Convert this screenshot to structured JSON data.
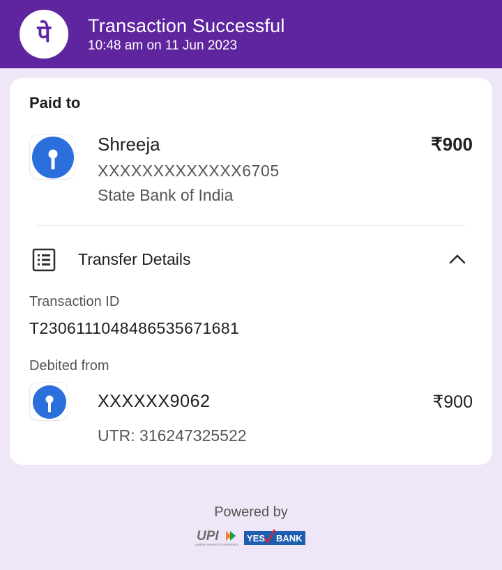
{
  "header": {
    "title": "Transaction Successful",
    "subtitle": "10:48 am on 11 Jun 2023",
    "logo_glyph": "पे",
    "logo_color": "#5f259f"
  },
  "paid_to": {
    "heading": "Paid to",
    "name": "Shreeja",
    "account": "XXXXXXXXXXXXX6705",
    "bank": "State Bank of India",
    "amount": "₹900",
    "bank_icon": "sbi-logo-icon"
  },
  "transfer_details": {
    "label": "Transfer Details",
    "icon": "receipt-list-icon",
    "expanded": true,
    "transaction_id_label": "Transaction ID",
    "transaction_id": "T2306111048486535671681",
    "debited_from_label": "Debited from",
    "debit_account": "XXXXXX9062",
    "debit_amount": "₹900",
    "utr": "UTR: 316247325522"
  },
  "footer": {
    "powered_by": "Powered by",
    "upi_text": "UPI",
    "upi_tagline": "UNIFIED PAYMENTS INTERFACE",
    "bank_text_1": "YES",
    "bank_text_2": "BANK"
  },
  "colors": {
    "brand_purple": "#5f259f",
    "background": "#efe6f7",
    "sbi_blue": "#2a6fdb",
    "yes_bank_blue": "#1d5eb0",
    "yes_bank_red": "#e0262b"
  }
}
